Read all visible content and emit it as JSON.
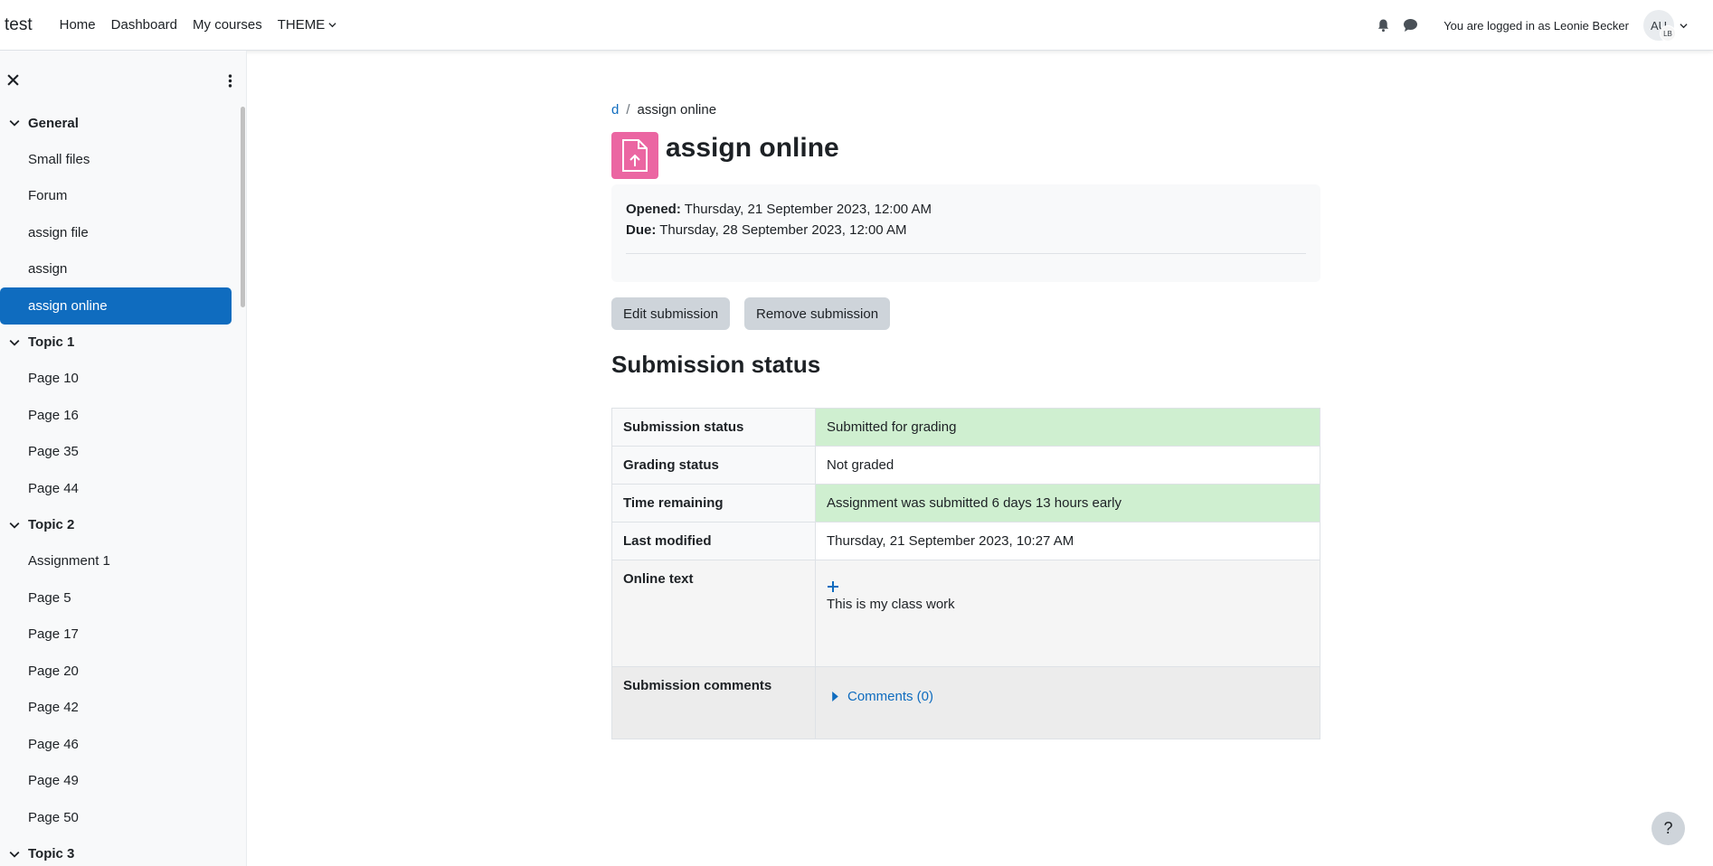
{
  "navbar": {
    "brand": "test",
    "links": [
      "Home",
      "Dashboard",
      "My courses",
      "THEME"
    ],
    "login_text": "You are logged in as Leonie Becker",
    "avatar_initials": "AU",
    "avatar_sub_initials": "LB"
  },
  "drawer": {
    "sections": [
      {
        "title": "General",
        "items": [
          "Small files",
          "Forum",
          "assign file",
          "assign",
          "assign online"
        ]
      },
      {
        "title": "Topic 1",
        "items": [
          "Page 10",
          "Page 16",
          "Page 35",
          "Page 44"
        ]
      },
      {
        "title": "Topic 2",
        "items": [
          "Assignment 1",
          "Page 5",
          "Page 17",
          "Page 20",
          "Page 42",
          "Page 46",
          "Page 49",
          "Page 50"
        ]
      },
      {
        "title": "Topic 3",
        "items": []
      }
    ],
    "active_item": "assign online"
  },
  "breadcrumb": {
    "items": [
      "d",
      "assign online"
    ],
    "separator": "/"
  },
  "page": {
    "title": "assign online",
    "opened_label": "Opened:",
    "opened_value": "Thursday, 21 September 2023, 12:00 AM",
    "due_label": "Due:",
    "due_value": "Thursday, 28 September 2023, 12:00 AM",
    "edit_button": "Edit submission",
    "remove_button": "Remove submission",
    "section_title": "Submission status"
  },
  "status_table": {
    "rows": [
      {
        "label": "Submission status",
        "value": "Submitted for grading"
      },
      {
        "label": "Grading status",
        "value": "Not graded"
      },
      {
        "label": "Time remaining",
        "value": "Assignment was submitted 6 days 13 hours early"
      },
      {
        "label": "Last modified",
        "value": "Thursday, 21 September 2023, 10:27 AM"
      },
      {
        "label": "Online text",
        "value": "This is my class work"
      },
      {
        "label": "Submission comments",
        "value": "Comments (0)"
      }
    ]
  },
  "help_label": "?",
  "colors": {
    "primary": "#0f6cbf",
    "assign_icon": "#eb66a2",
    "success_bg": "#cfefd0"
  }
}
